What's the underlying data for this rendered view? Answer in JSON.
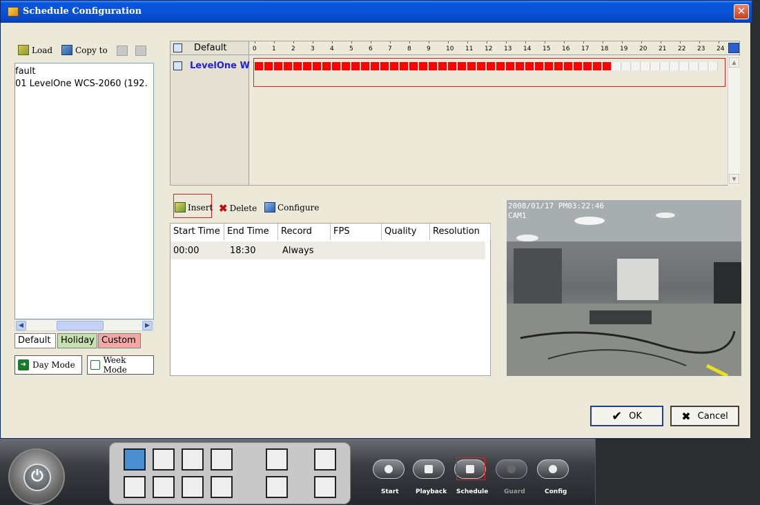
{
  "window": {
    "title": "Schedule Configuration",
    "close_glyph": "✕"
  },
  "left_toolbar": {
    "load_label": "Load",
    "copy_to_label": "Copy to"
  },
  "schedule_list": {
    "items": [
      "fault",
      "01 LevelOne WCS-2060 (192."
    ]
  },
  "tabs": [
    {
      "label": "Default",
      "color": "#ffffff"
    },
    {
      "label": "Holiday",
      "color": "#c6e0b0"
    },
    {
      "label": "Custom",
      "color": "#f3a7a7"
    }
  ],
  "modes": {
    "day_label": "Day Mode",
    "week_label": "Week Mode"
  },
  "timeline": {
    "header_label": "Default",
    "row_label": "LevelOne W",
    "hours": [
      "0",
      "1",
      "2",
      "3",
      "4",
      "5",
      "6",
      "7",
      "8",
      "9",
      "10",
      "11",
      "12",
      "13",
      "14",
      "15",
      "16",
      "17",
      "18",
      "19",
      "20",
      "21",
      "22",
      "23",
      "24"
    ],
    "record_end_hour": 18.5,
    "bar_color": "#ff0000"
  },
  "actions": {
    "insert_label": "Insert",
    "delete_label": "Delete",
    "configure_label": "Configure"
  },
  "table": {
    "columns": [
      "Start Time",
      "End Time",
      "Record",
      "FPS",
      "Quality",
      "Resolution"
    ],
    "rows": [
      {
        "start": "00:00",
        "end": "18:30",
        "record": "Always"
      }
    ]
  },
  "video": {
    "timestamp": "2008/01/17 PM03:22:46",
    "camera": "CAM1"
  },
  "buttons": {
    "ok_label": "OK",
    "cancel_label": "Cancel"
  },
  "taskbar": {
    "start_label": "Start",
    "playback_label": "Playback",
    "schedule_label": "Schedule",
    "guard_label": "Guard",
    "config_label": "Config"
  }
}
